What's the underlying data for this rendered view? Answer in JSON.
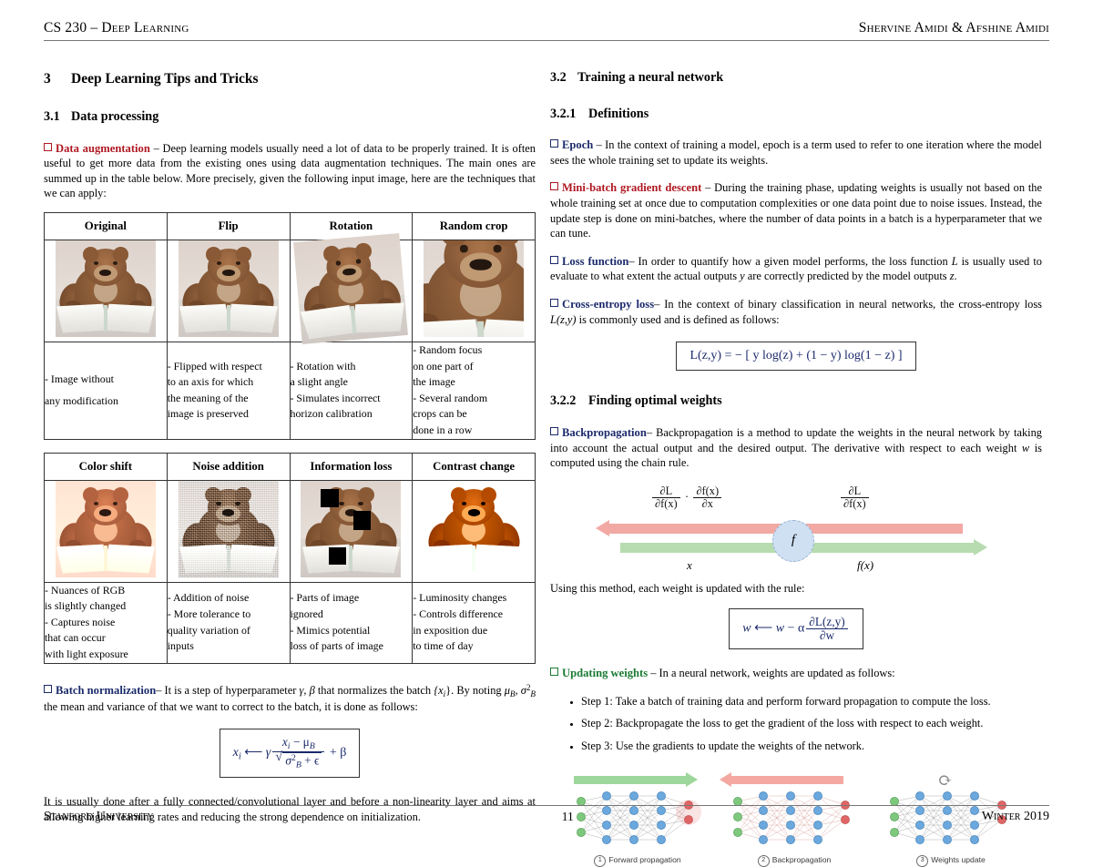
{
  "header": {
    "left": "CS 230 – Deep Learning",
    "right": "Shervine Amidi & Afshine Amidi"
  },
  "footer": {
    "left": "Stanford University",
    "page": "11",
    "right": "Winter 2019"
  },
  "left_column": {
    "section3": {
      "number": "3",
      "title": "Deep Learning Tips and Tricks"
    },
    "section31": {
      "number": "3.1",
      "title": "Data processing"
    },
    "data_augmentation": {
      "term": "Data augmentation",
      "color": "#b01822",
      "body": "– Deep learning models usually need a lot of data to be properly trained. It is often useful to get more data from the existing ones using data augmentation techniques. The main ones are summed up in the table below. More precisely, given the following input image, here are the techniques that we can apply:"
    },
    "table1": {
      "headers": [
        "Original",
        "Flip",
        "Rotation",
        "Random crop"
      ],
      "captions": [
        [
          "- Image without",
          "any modification"
        ],
        [
          "- Flipped with respect",
          "to an axis for which",
          "the meaning of the",
          "image is preserved"
        ],
        [
          "- Rotation with",
          "a slight angle",
          "- Simulates incorrect",
          "horizon calibration"
        ],
        [
          "- Random focus",
          "on one part of",
          "the image",
          "- Several random",
          "crops can be",
          "done in a row"
        ]
      ]
    },
    "table2": {
      "headers": [
        "Color shift",
        "Noise addition",
        "Information loss",
        "Contrast change"
      ],
      "captions": [
        [
          "- Nuances of RGB",
          "is slightly changed",
          "- Captures noise",
          "that can occur",
          "with light exposure"
        ],
        [
          "- Addition of noise",
          "- More tolerance to",
          "quality variation of",
          "inputs"
        ],
        [
          "- Parts of image",
          "ignored",
          "- Mimics potential",
          "loss of parts of image"
        ],
        [
          "- Luminosity changes",
          "- Controls difference",
          "in exposition due",
          "to time of day"
        ]
      ]
    },
    "batch_norm": {
      "term": "Batch normalization",
      "color": "#1b2a6b",
      "body_part1": "– It is a step of hyperparameter ",
      "gamma_beta": "γ, β",
      "body_part2": " that normalizes the batch ",
      "batch_sym": "{x",
      "batch_sym_sub": "i",
      "batch_sym_end": "}.",
      "body_part3": " By noting ",
      "mu_sigma": "μ",
      "mu_sub": "B",
      "sigma_sym": ", σ",
      "sigma_sup": "2",
      "sigma_sub": "B",
      "body_part4": " the mean and variance of that we want to correct to the batch, it is done as follows:",
      "equation": {
        "lhs": "x",
        "lhs_sub": "i",
        "arrow": "⟵",
        "gamma": "γ",
        "num": "x",
        "num_sub": "i",
        "num_minus": " − μ",
        "num_sub2": "B",
        "den_sigma": "σ",
        "den_sup": "2",
        "den_sub": "B",
        "den_eps": " + ϵ",
        "plus_beta": "+ β"
      },
      "closing": "It is usually done after a fully connected/convolutional layer and before a non-linearity layer and aims at allowing higher learning rates and reducing the strong dependence on initialization."
    }
  },
  "right_column": {
    "section32": {
      "number": "3.2",
      "title": "Training a neural network"
    },
    "section321": {
      "number": "3.2.1",
      "title": "Definitions"
    },
    "epoch": {
      "term": "Epoch",
      "color": "#1b2a6b",
      "body": "– In the context of training a model, epoch is a term used to refer to one iteration where the model sees the whole training set to update its weights."
    },
    "minibatch": {
      "term": "Mini-batch gradient descent",
      "color": "#b01822",
      "body": "– During the training phase, updating weights is usually not based on the whole training set at once due to computation complexities or one data point due to noise issues. Instead, the update step is done on mini-batches, where the number of data points in a batch is a hyperparameter that we can tune."
    },
    "loss_function": {
      "term": "Loss function",
      "color": "#1b2a6b",
      "body_a": "– In order to quantify how a given model performs, the loss function ",
      "L": "L",
      "body_b": " is usually used to evaluate to what extent the actual outputs ",
      "y": "y",
      "body_c": " are correctly predicted by the model outputs ",
      "z": "z",
      "body_d": "."
    },
    "cross_entropy": {
      "term": "Cross-entropy loss",
      "color": "#1b2a6b",
      "body_a": "– In the context of binary classification in neural networks, the cross-entropy loss ",
      "Lzy": "L(z,y)",
      "body_b": " is commonly used and is defined as follows:",
      "equation": "L(z,y) = − [ y log(z) + (1 − y) log(1 − z) ]"
    },
    "section322": {
      "number": "3.2.2",
      "title": "Finding optimal weights"
    },
    "backprop": {
      "term": "Backpropagation",
      "color": "#1b2a6b",
      "body_a": "– Backpropagation is a method to update the weights in the neural network by taking into account the actual output and the desired output. The derivative with respect to each weight ",
      "w": "w",
      "body_b": " is computed using the chain rule."
    },
    "bp_diagram": {
      "left_frac1_num": "∂L",
      "left_frac1_den": "∂f(x)",
      "dot": "·",
      "left_frac2_num": "∂f(x)",
      "left_frac2_den": "∂x",
      "right_frac_num": "∂L",
      "right_frac_den": "∂f(x)",
      "node_label": "f",
      "bottom_left": "x",
      "bottom_right": "f(x)",
      "arrow_back_color": "#f2a9a4",
      "arrow_forward_color": "#b6dcaf",
      "node_color": "#cfe0f2"
    },
    "update_rule": {
      "intro": "Using this method, each weight is updated with the rule:",
      "equation": {
        "w": "w",
        "arrow": "⟵",
        "w2": "w",
        "minus_alpha": "− α",
        "num": "∂L(z,y)",
        "den": "∂w"
      }
    },
    "updating_weights": {
      "term": "Updating weights",
      "color": "#1a7a32",
      "body": "– In a neural network, weights are updated as follows:",
      "steps": [
        "Step 1: Take a batch of training data and perform forward propagation to compute the loss.",
        "Step 2: Backpropagate the loss to get the gradient of the loss with respect to each weight.",
        "Step 3: Use the gradients to update the weights of the network."
      ]
    },
    "nn_diagrams": [
      {
        "num": "1",
        "label": "Forward propagation",
        "arrow": "forward-arrow-green",
        "arrow_color": "#9ed79b",
        "edge_color": "#6b6b6b"
      },
      {
        "num": "2",
        "label": "Backpropagation",
        "arrow": "backward-arrow-red",
        "arrow_color": "#f4a8a2",
        "edge_color": "#cf8d88"
      },
      {
        "num": "3",
        "label": "Weights update",
        "arrow": "refresh-icon",
        "arrow_color": "#8a8a8a",
        "edge_color": "#6b6b6b"
      }
    ]
  },
  "colors": {
    "input_node": "#79c879",
    "hidden_node": "#6aa8dd",
    "output_node": "#e06666",
    "red_term": "#b01822",
    "blue_term": "#1b2a6b",
    "green_term": "#1a7a32"
  }
}
